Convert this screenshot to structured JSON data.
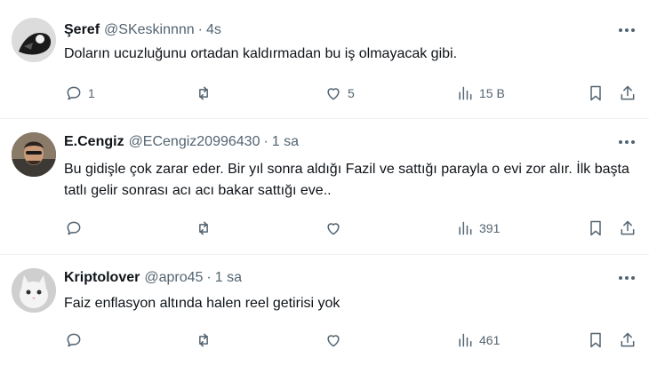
{
  "tweets": [
    {
      "name": "Şeref",
      "handle": "@SKeskinnnn",
      "time": "4s",
      "text": "Doların ucuzluğunu ortadan kaldırmadan bu iş olmayacak gibi.",
      "replies": "1",
      "retweets": "",
      "likes": "5",
      "views": "15 B"
    },
    {
      "name": "E.Cengiz",
      "handle": "@ECengiz20996430",
      "time": "1 sa",
      "text": "Bu gidişle çok zarar eder. Bir yıl sonra aldığı Fazil ve sattığı parayla o evi zor alır. İlk başta tatlı gelir sonrası acı acı bakar sattığı eve..",
      "replies": "",
      "retweets": "",
      "likes": "",
      "views": "391"
    },
    {
      "name": "Kriptolover",
      "handle": "@apro45",
      "time": "1 sa",
      "text": "Faiz enflasyon altında halen reel getirisi yok",
      "replies": "",
      "retweets": "",
      "likes": "",
      "views": "461"
    }
  ],
  "separator": "·",
  "icons": {
    "reply": "reply-icon",
    "retweet": "retweet-icon",
    "like": "heart-icon",
    "views": "views-icon",
    "bookmark": "bookmark-icon",
    "share": "share-icon",
    "more": "more-icon"
  },
  "colors": {
    "text": "#0f1419",
    "secondary": "#536471",
    "divider": "#eff3f4"
  }
}
